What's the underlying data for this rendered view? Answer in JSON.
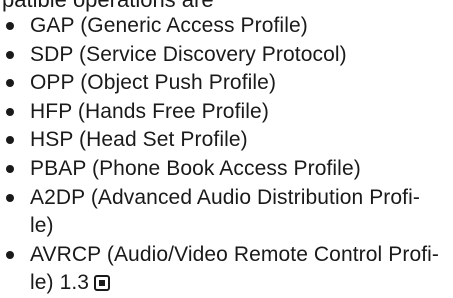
{
  "top_cut_text": "patible operations  are",
  "profiles": [
    {
      "lines": [
        "GAP (Generic Access Profile)"
      ]
    },
    {
      "lines": [
        "SDP (Service Discovery Protocol)"
      ]
    },
    {
      "lines": [
        "OPP (Object Push Profile)"
      ]
    },
    {
      "lines": [
        "HFP (Hands Free Profile)"
      ]
    },
    {
      "lines": [
        "HSP (Head Set Profile)"
      ]
    },
    {
      "lines": [
        "PBAP (Phone Book Access Profile)"
      ]
    },
    {
      "lines": [
        "A2DP (Advanced Audio Distribution Profi-",
        "le)"
      ]
    },
    {
      "lines": [
        "AVRCP (Audio/Video Remote Control Profi-",
        "le) 1.3"
      ]
    }
  ],
  "end_icon": "end-mark-icon"
}
